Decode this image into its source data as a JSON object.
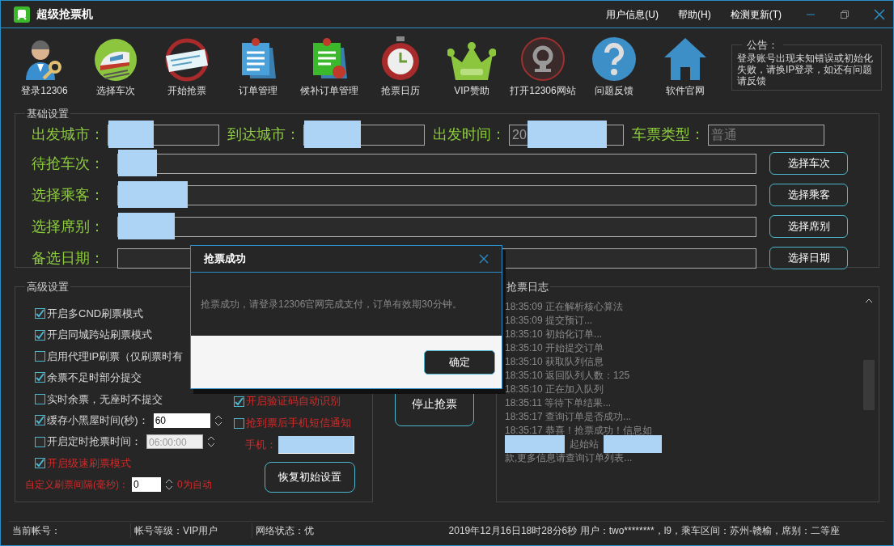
{
  "window": {
    "title": "超级抢票机",
    "menu": [
      "用户信息(U)",
      "帮助(H)",
      "检测更新(T)"
    ]
  },
  "toolbar": [
    {
      "label": "登录12306"
    },
    {
      "label": "选择车次"
    },
    {
      "label": "开始抢票"
    },
    {
      "label": "订单管理"
    },
    {
      "label": "候补订单管理"
    },
    {
      "label": "抢票日历"
    },
    {
      "label": "VIP赞助"
    },
    {
      "label": "打开12306网站"
    },
    {
      "label": "问题反馈"
    },
    {
      "label": "软件官网"
    }
  ],
  "notice": {
    "title": "公告：",
    "text": "登录账号出现未知错误或初始化失败，请换IP登录，如还有问题请反馈"
  },
  "basic_settings": {
    "title": "基础设置",
    "top_fields": [
      {
        "label": "出发城市："
      },
      {
        "label": "到达城市："
      },
      {
        "label": "出发时间：",
        "value": "20"
      },
      {
        "label": "车票类型：",
        "placeholder": "普通"
      }
    ],
    "rows": [
      {
        "label": "待抢车次：",
        "button": "选择车次"
      },
      {
        "label": "选择乘客：",
        "button": "选择乘客"
      },
      {
        "label": "选择席别：",
        "button": "选择席别"
      },
      {
        "label": "备选日期：",
        "button": "选择日期"
      }
    ]
  },
  "advanced_settings": {
    "title": "高级设置",
    "options": [
      {
        "kind": "checkbox",
        "label": "开启多CND刷票模式",
        "checked": true,
        "warning": false
      },
      {
        "kind": "checkbox",
        "label": "开启同城跨站刷票模式",
        "checked": true,
        "warning": false
      },
      {
        "kind": "checkbox",
        "label": "启用代理IP刷票（仅刷票时有",
        "checked": false,
        "warning": false
      },
      {
        "kind": "checkbox",
        "label": "余票不足时部分提交",
        "checked": true,
        "warning": false
      },
      {
        "kind": "checkbox",
        "label": "实时余票，无座时不提交",
        "checked": false,
        "warning": false
      },
      {
        "kind": "spin",
        "label": "缓存小黑屋时间(秒)：",
        "checked": true,
        "warning": false,
        "value": "60",
        "disabled": false
      },
      {
        "kind": "time",
        "label": "开启定时抢票时间：",
        "checked": false,
        "warning": false,
        "value": "06:00:00",
        "disabled": true
      },
      {
        "kind": "checkbox",
        "label": "开启级速刷票模式",
        "checked": true,
        "warning": true
      }
    ],
    "interval": {
      "label": "自定义刷票间隔(毫秒)：",
      "value": "0",
      "hint": "0为自动"
    },
    "side_options": [
      {
        "label": "开启验证码自动识别",
        "checked": true,
        "warning": true
      },
      {
        "label": "抢到票后手机短信通知",
        "checked": false,
        "warning": true
      }
    ],
    "phone": {
      "label": "手机："
    },
    "reset_button": "恢复初始设置"
  },
  "stop_button": "停止抢票",
  "log": {
    "title": "抢票日志",
    "lines": [
      {
        "kind": "text",
        "text": "18:35:09 正在解析核心算法"
      },
      {
        "kind": "text",
        "text": "18:35:09 提交预订..."
      },
      {
        "kind": "text",
        "text": "18:35:10 初始化订单..."
      },
      {
        "kind": "text",
        "text": "18:35:10 开始提交订单"
      },
      {
        "kind": "text",
        "text": "18:35:10 获取队列信息"
      },
      {
        "kind": "text",
        "text": "18:35:10 返回队列人数：125"
      },
      {
        "kind": "text",
        "text": "18:35:10 正在加入队列"
      },
      {
        "kind": "text",
        "text": "18:35:11 等待下单结果..."
      },
      {
        "kind": "text",
        "text": "18:35:17 查询订单是否成功..."
      },
      {
        "kind": "text",
        "text": "18:35:17 恭喜！抢票成功！信息如"
      },
      {
        "kind": "redacted",
        "text": "起始站"
      },
      {
        "kind": "text",
        "text": "款,更多信息请查询订单列表..."
      }
    ]
  },
  "status_bar": {
    "account": "当前帐号：",
    "level": "帐号等级：VIP用户",
    "network": "网络状态：优",
    "info": "2019年12月16日18时28分6秒 用户：two********，l9，乘车区间：苏州-赣榆，席别：二等座"
  },
  "dialog": {
    "title": "抢票成功",
    "message": "抢票成功，请登录12306官网完成支付，订单有效期30分钟。",
    "ok": "确定"
  }
}
